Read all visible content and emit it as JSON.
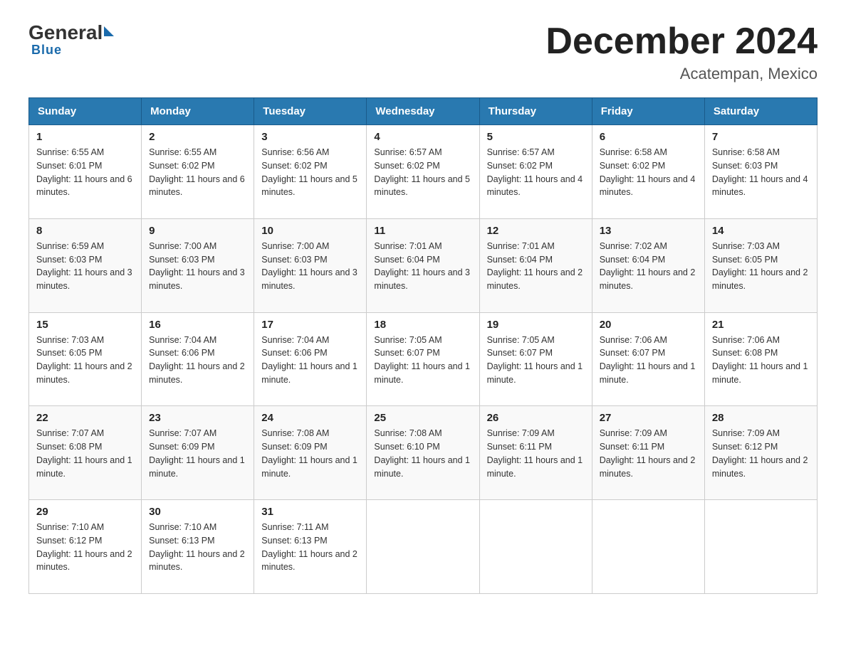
{
  "header": {
    "logo_general": "General",
    "logo_blue": "Blue",
    "main_title": "December 2024",
    "subtitle": "Acatempan, Mexico"
  },
  "days_of_week": [
    "Sunday",
    "Monday",
    "Tuesday",
    "Wednesday",
    "Thursday",
    "Friday",
    "Saturday"
  ],
  "weeks": [
    [
      {
        "day": "1",
        "sunrise": "6:55 AM",
        "sunset": "6:01 PM",
        "daylight": "11 hours and 6 minutes."
      },
      {
        "day": "2",
        "sunrise": "6:55 AM",
        "sunset": "6:02 PM",
        "daylight": "11 hours and 6 minutes."
      },
      {
        "day": "3",
        "sunrise": "6:56 AM",
        "sunset": "6:02 PM",
        "daylight": "11 hours and 5 minutes."
      },
      {
        "day": "4",
        "sunrise": "6:57 AM",
        "sunset": "6:02 PM",
        "daylight": "11 hours and 5 minutes."
      },
      {
        "day": "5",
        "sunrise": "6:57 AM",
        "sunset": "6:02 PM",
        "daylight": "11 hours and 4 minutes."
      },
      {
        "day": "6",
        "sunrise": "6:58 AM",
        "sunset": "6:02 PM",
        "daylight": "11 hours and 4 minutes."
      },
      {
        "day": "7",
        "sunrise": "6:58 AM",
        "sunset": "6:03 PM",
        "daylight": "11 hours and 4 minutes."
      }
    ],
    [
      {
        "day": "8",
        "sunrise": "6:59 AM",
        "sunset": "6:03 PM",
        "daylight": "11 hours and 3 minutes."
      },
      {
        "day": "9",
        "sunrise": "7:00 AM",
        "sunset": "6:03 PM",
        "daylight": "11 hours and 3 minutes."
      },
      {
        "day": "10",
        "sunrise": "7:00 AM",
        "sunset": "6:03 PM",
        "daylight": "11 hours and 3 minutes."
      },
      {
        "day": "11",
        "sunrise": "7:01 AM",
        "sunset": "6:04 PM",
        "daylight": "11 hours and 3 minutes."
      },
      {
        "day": "12",
        "sunrise": "7:01 AM",
        "sunset": "6:04 PM",
        "daylight": "11 hours and 2 minutes."
      },
      {
        "day": "13",
        "sunrise": "7:02 AM",
        "sunset": "6:04 PM",
        "daylight": "11 hours and 2 minutes."
      },
      {
        "day": "14",
        "sunrise": "7:03 AM",
        "sunset": "6:05 PM",
        "daylight": "11 hours and 2 minutes."
      }
    ],
    [
      {
        "day": "15",
        "sunrise": "7:03 AM",
        "sunset": "6:05 PM",
        "daylight": "11 hours and 2 minutes."
      },
      {
        "day": "16",
        "sunrise": "7:04 AM",
        "sunset": "6:06 PM",
        "daylight": "11 hours and 2 minutes."
      },
      {
        "day": "17",
        "sunrise": "7:04 AM",
        "sunset": "6:06 PM",
        "daylight": "11 hours and 1 minute."
      },
      {
        "day": "18",
        "sunrise": "7:05 AM",
        "sunset": "6:07 PM",
        "daylight": "11 hours and 1 minute."
      },
      {
        "day": "19",
        "sunrise": "7:05 AM",
        "sunset": "6:07 PM",
        "daylight": "11 hours and 1 minute."
      },
      {
        "day": "20",
        "sunrise": "7:06 AM",
        "sunset": "6:07 PM",
        "daylight": "11 hours and 1 minute."
      },
      {
        "day": "21",
        "sunrise": "7:06 AM",
        "sunset": "6:08 PM",
        "daylight": "11 hours and 1 minute."
      }
    ],
    [
      {
        "day": "22",
        "sunrise": "7:07 AM",
        "sunset": "6:08 PM",
        "daylight": "11 hours and 1 minute."
      },
      {
        "day": "23",
        "sunrise": "7:07 AM",
        "sunset": "6:09 PM",
        "daylight": "11 hours and 1 minute."
      },
      {
        "day": "24",
        "sunrise": "7:08 AM",
        "sunset": "6:09 PM",
        "daylight": "11 hours and 1 minute."
      },
      {
        "day": "25",
        "sunrise": "7:08 AM",
        "sunset": "6:10 PM",
        "daylight": "11 hours and 1 minute."
      },
      {
        "day": "26",
        "sunrise": "7:09 AM",
        "sunset": "6:11 PM",
        "daylight": "11 hours and 1 minute."
      },
      {
        "day": "27",
        "sunrise": "7:09 AM",
        "sunset": "6:11 PM",
        "daylight": "11 hours and 2 minutes."
      },
      {
        "day": "28",
        "sunrise": "7:09 AM",
        "sunset": "6:12 PM",
        "daylight": "11 hours and 2 minutes."
      }
    ],
    [
      {
        "day": "29",
        "sunrise": "7:10 AM",
        "sunset": "6:12 PM",
        "daylight": "11 hours and 2 minutes."
      },
      {
        "day": "30",
        "sunrise": "7:10 AM",
        "sunset": "6:13 PM",
        "daylight": "11 hours and 2 minutes."
      },
      {
        "day": "31",
        "sunrise": "7:11 AM",
        "sunset": "6:13 PM",
        "daylight": "11 hours and 2 minutes."
      },
      null,
      null,
      null,
      null
    ]
  ],
  "labels": {
    "sunrise": "Sunrise:",
    "sunset": "Sunset:",
    "daylight": "Daylight:"
  }
}
